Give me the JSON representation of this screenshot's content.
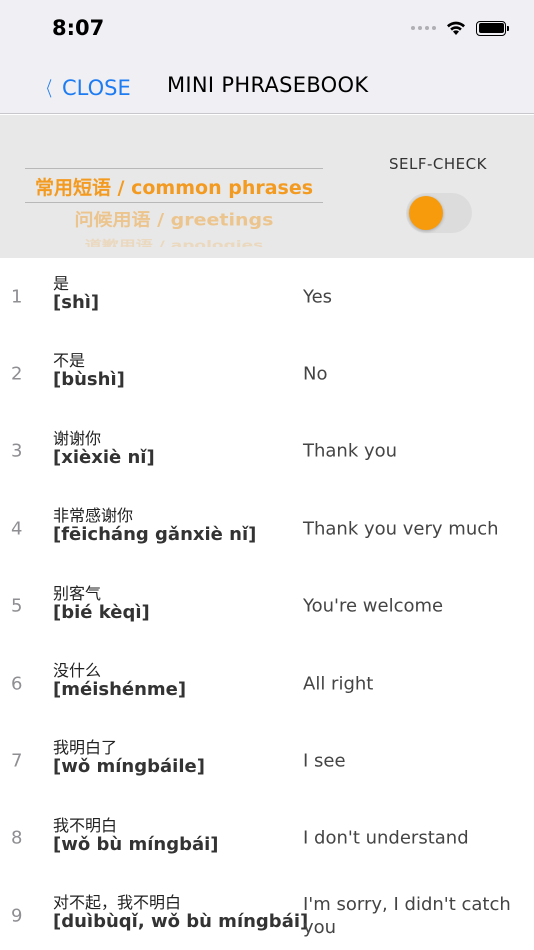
{
  "status_bar": {
    "time": "8:07"
  },
  "nav": {
    "close_label": "CLOSE",
    "title": "MINI PHRASEBOOK"
  },
  "picker": {
    "items": [
      "常用短语 / common phrases",
      "问候用语 / greetings",
      "道歉用语 / apologies"
    ]
  },
  "self_check": {
    "label": "SELF-CHECK",
    "enabled": false
  },
  "colors": {
    "accent": "#1e7cf2",
    "picker_text": "#f39a20",
    "toggle_knob": "#f79b0c"
  },
  "phrases": [
    {
      "num": "1",
      "zh": "是",
      "pinyin": "[shì]",
      "en": "Yes"
    },
    {
      "num": "2",
      "zh": "不是",
      "pinyin": "[bùshì]",
      "en": "No"
    },
    {
      "num": "3",
      "zh": "谢谢你",
      "pinyin": "[xièxiè nǐ]",
      "en": "Thank you"
    },
    {
      "num": "4",
      "zh": "非常感谢你",
      "pinyin": "[fēicháng gǎnxiè nǐ]",
      "en": "Thank you very much"
    },
    {
      "num": "5",
      "zh": "别客气",
      "pinyin": "[bié kèqì]",
      "en": "You're welcome"
    },
    {
      "num": "6",
      "zh": "没什么",
      "pinyin": "[méishénme]",
      "en": "All right"
    },
    {
      "num": "7",
      "zh": "我明白了",
      "pinyin": "[wǒ míngbáile]",
      "en": "I see"
    },
    {
      "num": "8",
      "zh": "我不明白",
      "pinyin": "[wǒ bù míngbái]",
      "en": "I don't understand"
    },
    {
      "num": "9",
      "zh": "对不起，我不明白",
      "pinyin": "[duìbùqǐ, wǒ bù míngbái]",
      "en": "I'm sorry, I didn't catch you"
    }
  ]
}
